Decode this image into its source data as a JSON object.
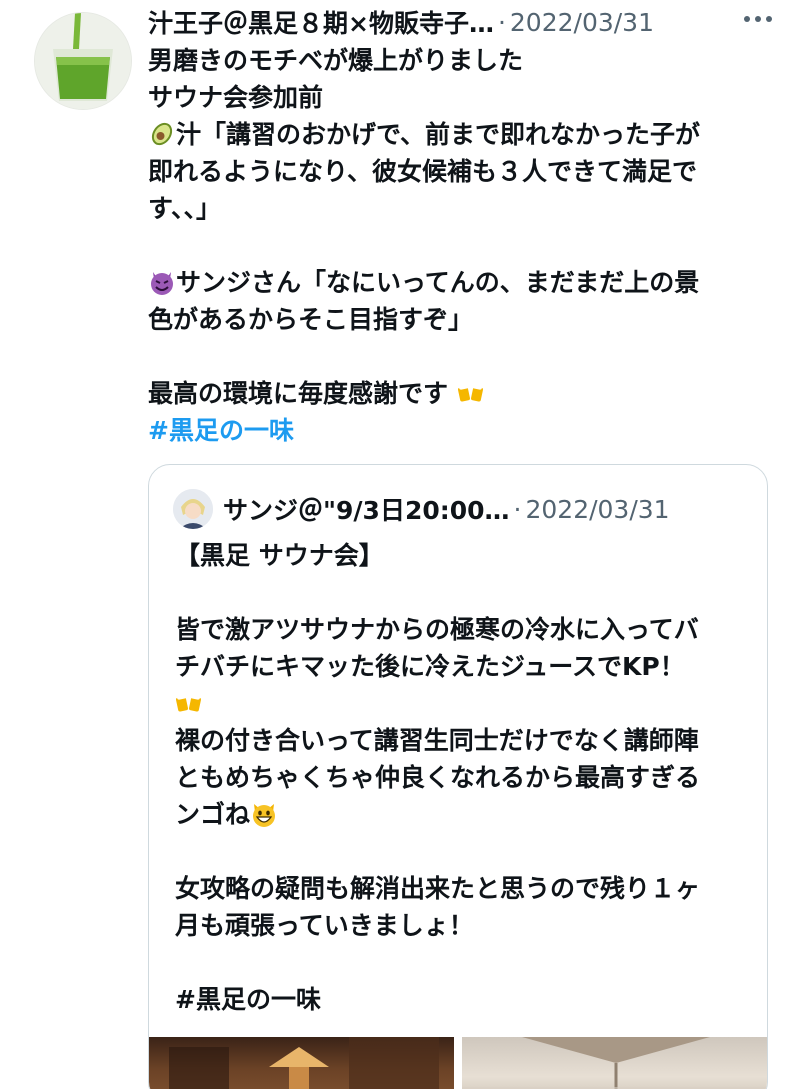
{
  "tweet": {
    "author_name": "汁王子＠黒足８期×物販寺子…",
    "separator": "·",
    "date": "2022/03/31",
    "lines": [
      "男磨きのモチベが爆上がりました",
      "サウナ会参加前",
      "汁「講習のおかげで、前まで即れなかった子が",
      "即れるようになり、彼女候補も３人できて満足で",
      "す、、」",
      "サンジさん「なにいってんの、まだまだ上の景",
      "色があるからそこ目指すぞ」",
      "最高の環境に毎度感謝です"
    ],
    "hashtag": "#黒足の一味"
  },
  "quoted": {
    "author_name": "サンジ＠\"9/3日20:00…",
    "separator": "·",
    "date": "2022/03/31",
    "lines": [
      "【黒足 サウナ会】",
      "皆で激アツサウナからの極寒の冷水に入ってバ",
      "チバチにキマッた後に冷えたジュースでKP！",
      "裸の付き合いって講習生同士だけでなく講師陣",
      "ともめちゃくちゃ仲良くなれるから最高すぎる",
      "ンゴね",
      "女攻略の疑問も解消出来たと思うので残り１ヶ",
      "月も頑張っていきましょ！",
      " #黒足の一味"
    ]
  },
  "icons": {
    "avatar": "green-juice-glass",
    "more": "more-icon",
    "avocado": "avocado-emoji",
    "devil": "smiling-devil-emoji",
    "beer": "clinking-beer-mugs-emoji",
    "cat": "grinning-cat-emoji"
  },
  "colors": {
    "text": "#0f1419",
    "muted": "#536471",
    "link": "#1d9bf0",
    "border": "#cfd9de"
  }
}
